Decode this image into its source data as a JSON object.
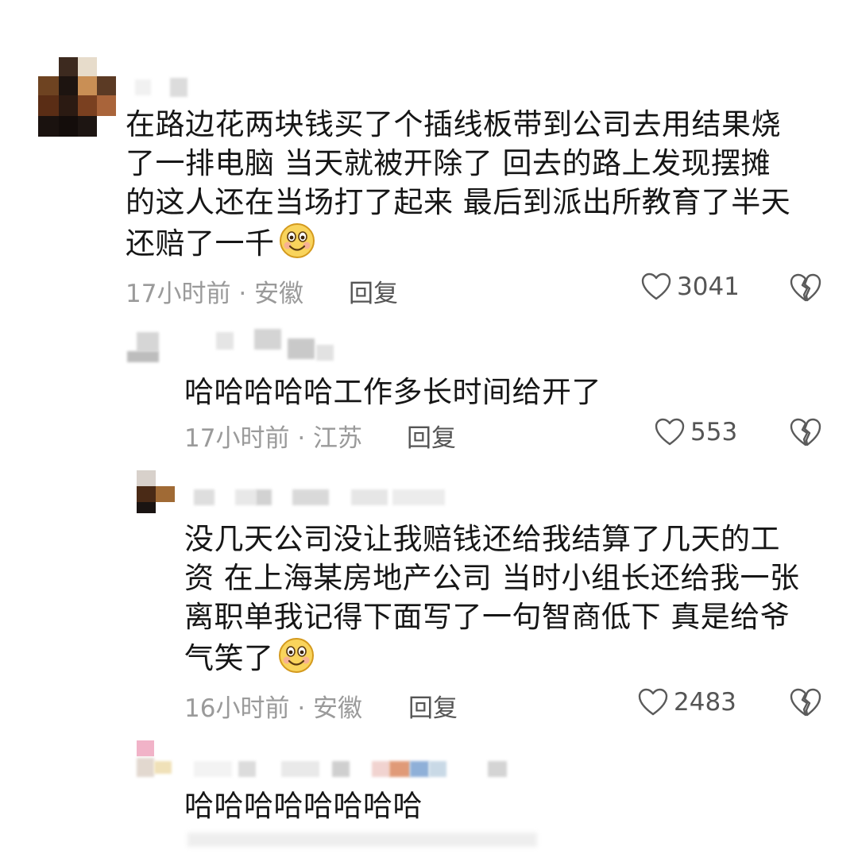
{
  "comments": [
    {
      "text_lines": [
        "在路边花两块钱买了个插线板带到公司去用结果烧",
        "了一排电脑 当天就被开除了 回去的路上发现摆摊",
        "的这人还在当场打了起来 最后到派出所教育了半天",
        "还赔了一千"
      ],
      "has_emoji": true,
      "emoji": "smiling-face-icon",
      "time": "17小时前",
      "location": "安徽",
      "reply_label": "回复",
      "likes": "3041"
    },
    {
      "text_lines": [
        "哈哈哈哈哈工作多长时间给开了"
      ],
      "has_emoji": false,
      "time": "17小时前",
      "location": "江苏",
      "reply_label": "回复",
      "likes": "553"
    },
    {
      "text_lines": [
        "没几天公司没让我赔钱还给我结算了几天的工",
        "资 在上海某房地产公司 当时小组长还给我一张",
        "离职单我记得下面写了一句智商低下 真是给爷",
        "气笑了"
      ],
      "has_emoji": true,
      "emoji": "smiling-face-icon",
      "time": "16小时前",
      "location": "安徽",
      "reply_label": "回复",
      "likes": "2483"
    },
    {
      "text_lines": [
        "哈哈哈哈哈哈哈哈"
      ],
      "has_emoji": false
    }
  ],
  "meta_separator": "·",
  "colors": {
    "text": "#161616",
    "meta": "#9a9a9a",
    "action": "#555555"
  }
}
